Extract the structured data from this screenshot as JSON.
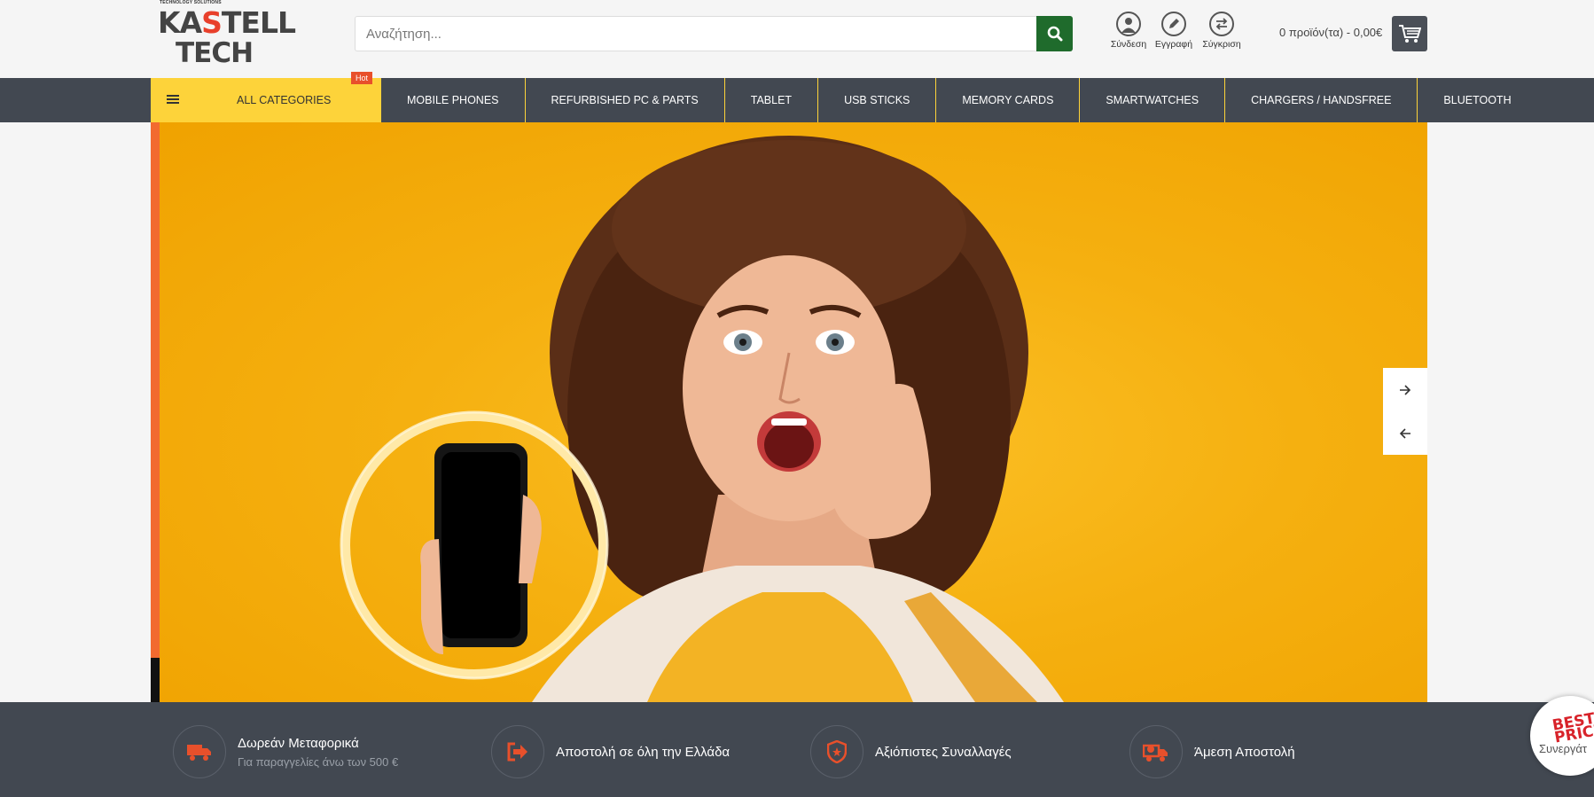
{
  "header": {
    "logo": {
      "tagline": "TECHNOLOGY SOLUTIONS",
      "line1_a": "KA",
      "line1_b": "S",
      "line1_c": "TELL",
      "line2": "TECH"
    },
    "search": {
      "placeholder": "Αναζήτηση..."
    },
    "icons": [
      {
        "label": "Σύνδεση",
        "icon": "user-icon"
      },
      {
        "label": "Εγγραφή",
        "icon": "pencil-icon"
      },
      {
        "label": "Σύγκριση",
        "icon": "compare-icon"
      }
    ],
    "cart": {
      "summary": "0 προϊόν(τα) - 0,00€",
      "icon": "cart-icon"
    }
  },
  "nav": {
    "all_categories": "ALL CATEGORIES",
    "hot_badge": "Hot",
    "items": [
      "MOBILE PHONES",
      "REFURBISHED PC & PARTS",
      "TABLET",
      "USB STICKS",
      "MEMORY CARDS",
      "SMARTWATCHES",
      "CHARGERS / HANDSFREE",
      "BLUETOOTH"
    ]
  },
  "slider": {
    "next_icon": "arrow-right-icon",
    "prev_icon": "arrow-left-icon"
  },
  "features": [
    {
      "title": "Δωρεάν Μεταφορικά",
      "subtitle": "Για παραγγελίες άνω των 500 €",
      "icon": "truck-icon"
    },
    {
      "title": "Αποστολή σε όλη την Ελλάδα",
      "subtitle": "",
      "icon": "arrow-out-icon"
    },
    {
      "title": "Αξιόπιστες Συναλλαγές",
      "subtitle": "",
      "icon": "shield-icon"
    },
    {
      "title": "Άμεση Αποστολή",
      "subtitle": "",
      "icon": "truck-icon"
    }
  ],
  "badge": {
    "line1": "BEST",
    "line2": "PRICE",
    "caption": "Συνεργάτ"
  },
  "colors": {
    "accent": "#fdd33a",
    "nav_bg": "#424851",
    "search_btn": "#1f6b2c",
    "orange": "#e8502b"
  }
}
